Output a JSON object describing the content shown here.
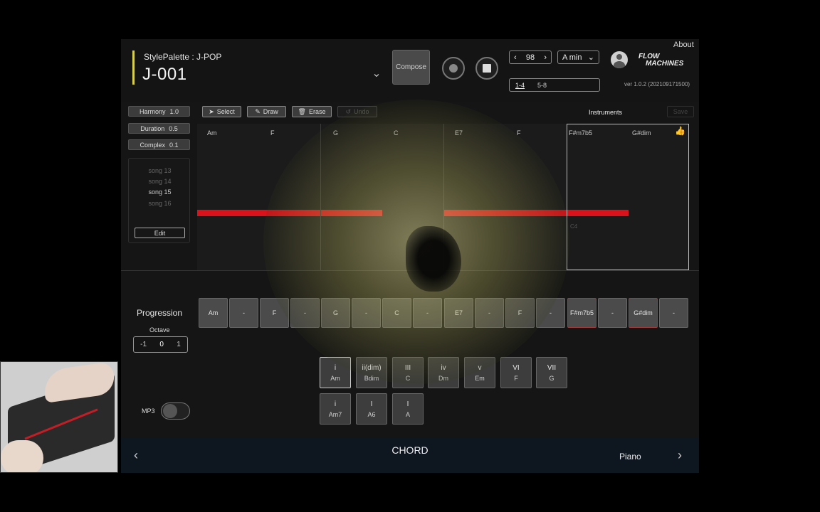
{
  "header": {
    "style_label": "StylePalette : J-POP",
    "song_title": "J-001",
    "compose_label": "Compose",
    "tempo_value": "98",
    "key_value": "A min",
    "bar_ranges": [
      "1-4",
      "5-8"
    ],
    "about_label": "About",
    "logo_line1": "FLOW",
    "logo_line2": "MACHINES",
    "version": "ver 1.0.2 (202109171500)"
  },
  "params": {
    "harmony_label": "Harmony",
    "harmony_value": "1.0",
    "duration_label": "Duration",
    "duration_value": "0.5",
    "complex_label": "Complex",
    "complex_value": "0.1"
  },
  "song_list": {
    "items": [
      "song 13",
      "song 14",
      "song 15",
      "song 16"
    ],
    "selected": "song 15",
    "edit_label": "Edit"
  },
  "toolbar": {
    "select_label": "Select",
    "draw_label": "Draw",
    "erase_label": "Erase",
    "undo_label": "Undo",
    "instruments_label": "Instruments",
    "save_label": "Save"
  },
  "roll": {
    "chords": [
      "Am",
      "F",
      "G",
      "C",
      "E7",
      "F",
      "F#m7b5",
      "G#dim"
    ],
    "note_label": "C4"
  },
  "progression": {
    "label": "Progression",
    "cells": [
      "Am",
      "-",
      "F",
      "-",
      "G",
      "-",
      "C",
      "-",
      "E7",
      "-",
      "F",
      "-",
      "F#m7b5",
      "-",
      "G#dim",
      "-"
    ]
  },
  "octave": {
    "label": "Octave",
    "options": [
      "-1",
      "0",
      "1"
    ],
    "selected": "0"
  },
  "degrees": {
    "row1": [
      {
        "degree": "i",
        "chord": "Am"
      },
      {
        "degree": "ii(dim)",
        "chord": "Bdim"
      },
      {
        "degree": "III",
        "chord": "C"
      },
      {
        "degree": "iv",
        "chord": "Dm"
      },
      {
        "degree": "v",
        "chord": "Em"
      },
      {
        "degree": "VI",
        "chord": "F"
      },
      {
        "degree": "VII",
        "chord": "G"
      }
    ],
    "row2": [
      {
        "degree": "i",
        "chord": "Am7"
      },
      {
        "degree": "I",
        "chord": "A6"
      },
      {
        "degree": "I",
        "chord": "A"
      }
    ]
  },
  "mp3_label": "MP3",
  "footer": {
    "title": "CHORD",
    "instrument": "Piano"
  },
  "colors": {
    "accent_bar": "#d8d04c",
    "note_red": "#d9121b",
    "footer_bg": "#0e1720"
  }
}
